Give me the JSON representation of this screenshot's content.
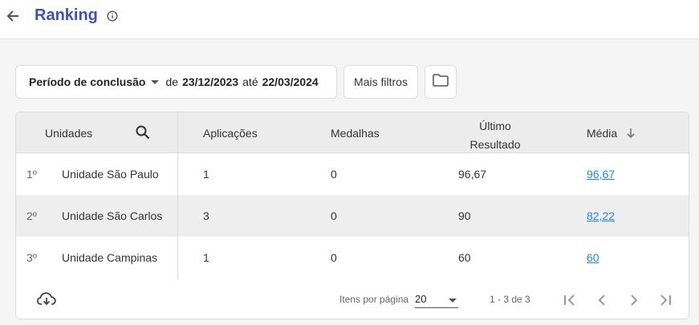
{
  "header": {
    "title": "Ranking",
    "back_icon": "arrow-left-icon",
    "info_icon": "info-circle-icon"
  },
  "filters": {
    "period_label": "Período de conclusão",
    "from_prefix": "de",
    "start_date": "23/12/2023",
    "to_word": "até",
    "end_date": "22/03/2024",
    "more_filters_label": "Mais filtros",
    "folder_icon": "folder-icon"
  },
  "table": {
    "headers": {
      "unidades": "Unidades",
      "aplicacoes": "Aplicações",
      "medalhas": "Medalhas",
      "ultimo_line1": "Último",
      "ultimo_line2": "Resultado",
      "media": "Média"
    },
    "rows": [
      {
        "rank": "1º",
        "unidade": "Unidade São Paulo",
        "aplicacoes": "1",
        "medalhas": "0",
        "ultimo": "96,67",
        "media": "96,67"
      },
      {
        "rank": "2º",
        "unidade": "Unidade São Carlos",
        "aplicacoes": "3",
        "medalhas": "0",
        "ultimo": "90",
        "media": "82,22"
      },
      {
        "rank": "3º",
        "unidade": "Unidade Campinas",
        "aplicacoes": "1",
        "medalhas": "0",
        "ultimo": "60",
        "media": "60"
      }
    ]
  },
  "footer": {
    "items_per_page_label": "Itens por página",
    "items_per_page_value": "20",
    "range_text": "1 - 3 de 3",
    "download_icon": "cloud-download-icon"
  },
  "colors": {
    "title": "#3f51b5",
    "link": "#1e88e5",
    "header_bg": "#ececec"
  }
}
